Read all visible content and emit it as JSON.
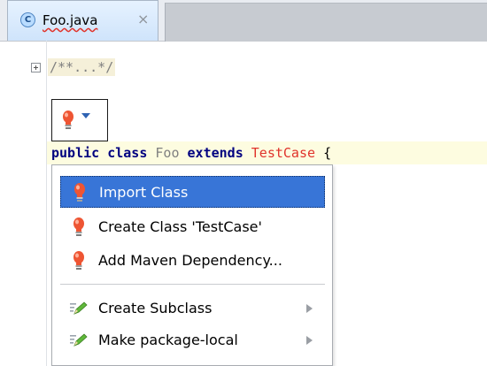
{
  "tab": {
    "icon_letter": "C",
    "title": "Foo.java",
    "close_glyph": "×"
  },
  "editor": {
    "folded_comment": "/**...*/",
    "code_tokens": {
      "kw_public": "public",
      "kw_class": "class",
      "class_name": "Foo",
      "kw_extends": "extends",
      "superclass": "TestCase",
      "brace": "{"
    }
  },
  "popup": {
    "items": [
      {
        "label": "Import Class",
        "icon": "lightbulb-red-icon",
        "selected": true
      },
      {
        "label": "Create Class 'TestCase'",
        "icon": "lightbulb-red-icon"
      },
      {
        "label": "Add Maven Dependency...",
        "icon": "lightbulb-red-icon"
      },
      {
        "label": "Create Subclass",
        "icon": "pencil-edit-icon",
        "submenu": true
      },
      {
        "label": "Make package-local",
        "icon": "pencil-edit-icon",
        "submenu": true
      }
    ]
  },
  "colors": {
    "selection": "#3875d7",
    "keyword": "#000080",
    "error": "#e0332b",
    "caret_line": "#fdfce0",
    "bulb_red": "#ee5533"
  }
}
